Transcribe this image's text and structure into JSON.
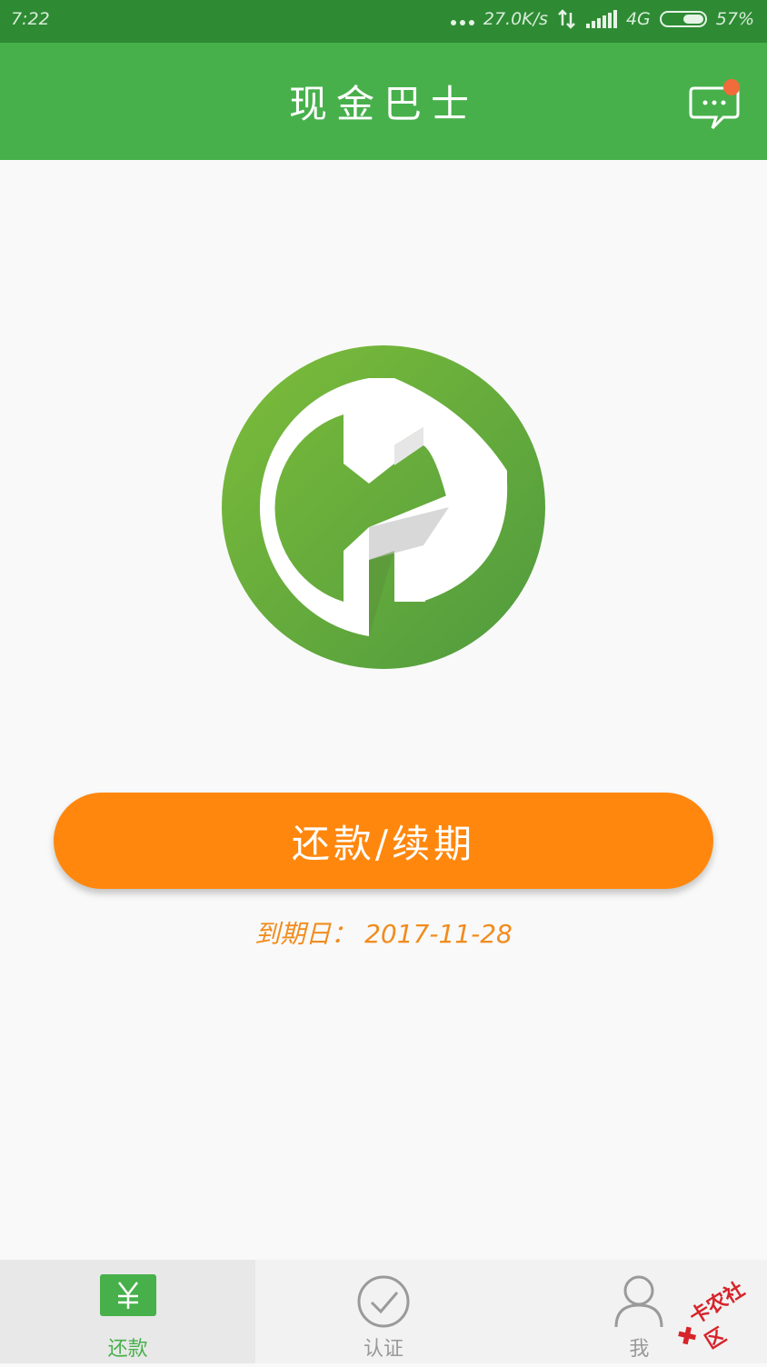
{
  "status_bar": {
    "time": "7:22",
    "network_speed": "27.0K/s",
    "network_type": "4G",
    "battery": "57%",
    "battery_level": 0.57
  },
  "app_bar": {
    "title": "现金巴士",
    "message_icon": "chat-bubble-icon",
    "has_notification": true
  },
  "main": {
    "logo_icon": "cash-bus-logo",
    "action_button": "还款/续期",
    "due_date_label": "到期日：",
    "due_date": "2017-11-28"
  },
  "tabs": [
    {
      "label": "还款",
      "icon": "yuan-icon",
      "active": true
    },
    {
      "label": "认证",
      "icon": "check-circle-icon",
      "active": false
    },
    {
      "label": "我",
      "icon": "user-icon",
      "active": false
    }
  ],
  "watermark": "卡农社区",
  "colors": {
    "primary_green": "#47b04b",
    "status_green": "#2e8b34",
    "accent_orange": "#ff870d",
    "due_text": "#f18c1e",
    "badge": "#f26b3a"
  }
}
